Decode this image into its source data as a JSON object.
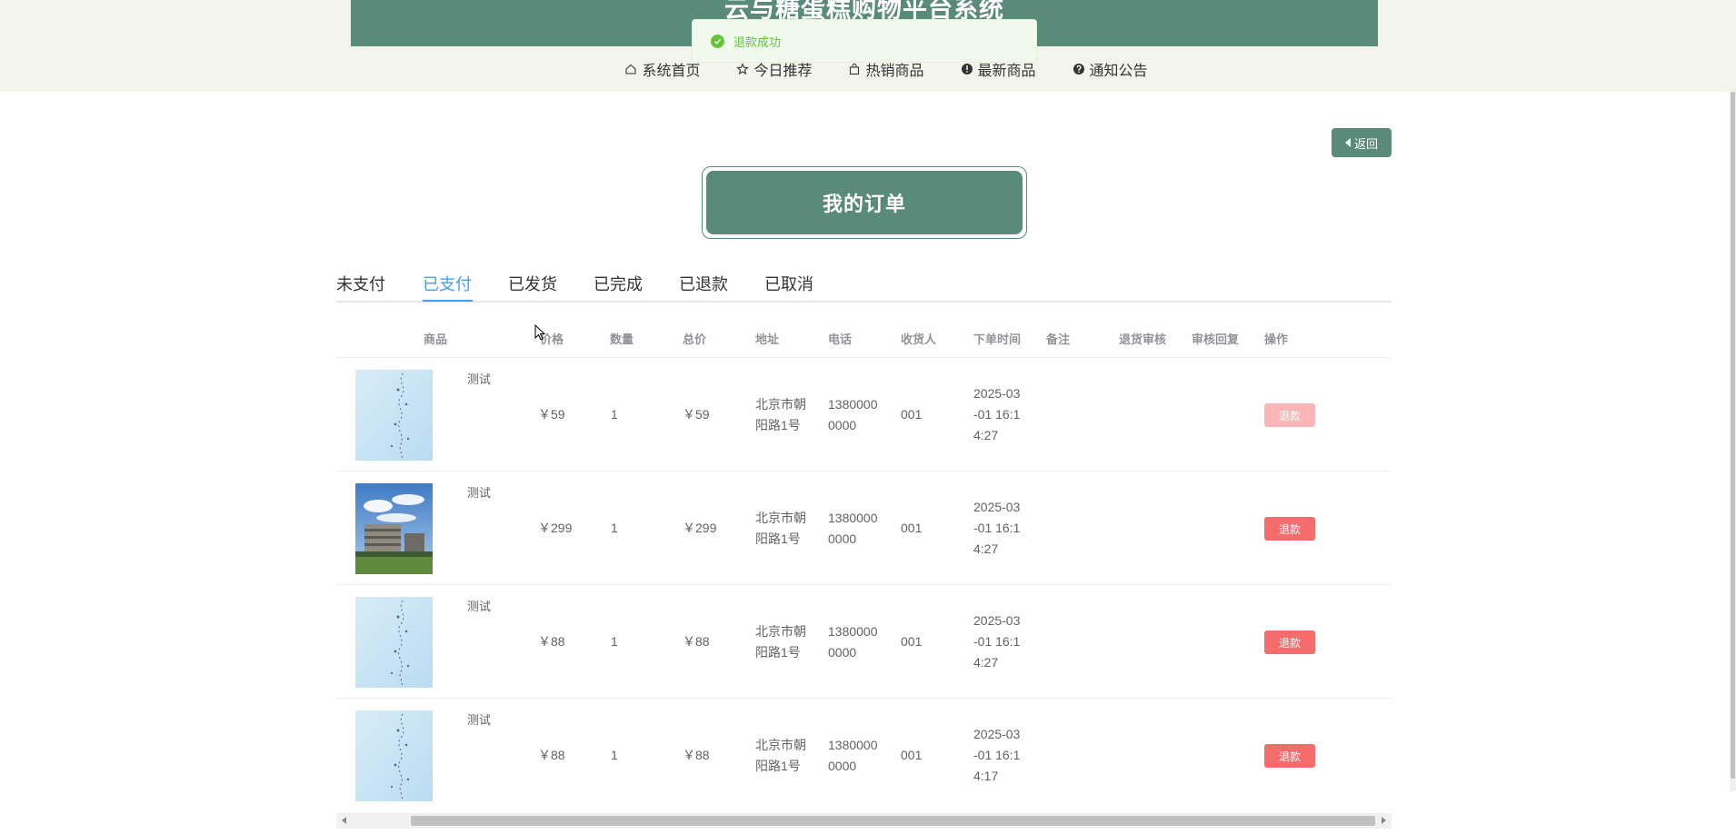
{
  "header": {
    "site_title": "云与糖蛋糕购物平台系统",
    "nav": [
      {
        "label": "系统首页",
        "icon": "home-icon"
      },
      {
        "label": "今日推荐",
        "icon": "star-icon"
      },
      {
        "label": "热销商品",
        "icon": "bag-icon"
      },
      {
        "label": "最新商品",
        "icon": "info-icon"
      },
      {
        "label": "通知公告",
        "icon": "question-icon"
      }
    ]
  },
  "toast": {
    "message": "退款成功",
    "icon": "success-check-icon"
  },
  "back_button": {
    "label": "返回"
  },
  "page_title": "我的订单",
  "tabs": {
    "items": [
      "未支付",
      "已支付",
      "已发货",
      "已完成",
      "已退款",
      "已取消"
    ],
    "active": "已支付"
  },
  "table": {
    "columns": [
      "商品",
      "价格",
      "数量",
      "总价",
      "地址",
      "电话",
      "收货人",
      "下单时间",
      "备注",
      "退货审核",
      "审核回复",
      "操作"
    ],
    "rows": [
      {
        "name": "测试",
        "price": "￥59",
        "qty": "1",
        "total": "￥59",
        "address_1": "北京市朝",
        "address_2": "阳路1号",
        "phone_1": "1380000",
        "phone_2": "0000",
        "receiver": "001",
        "time_1": "2025-03",
        "time_2": "-01 16:1",
        "time_3": "4:27",
        "image": "water-drops-photo",
        "action": "退款",
        "action_disabled": true
      },
      {
        "name": "测试",
        "price": "￥299",
        "qty": "1",
        "total": "￥299",
        "address_1": "北京市朝",
        "address_2": "阳路1号",
        "phone_1": "1380000",
        "phone_2": "0000",
        "receiver": "001",
        "time_1": "2025-03",
        "time_2": "-01 16:1",
        "time_3": "4:27",
        "image": "building-photo",
        "action": "退款",
        "action_disabled": false
      },
      {
        "name": "测试",
        "price": "￥88",
        "qty": "1",
        "total": "￥88",
        "address_1": "北京市朝",
        "address_2": "阳路1号",
        "phone_1": "1380000",
        "phone_2": "0000",
        "receiver": "001",
        "time_1": "2025-03",
        "time_2": "-01 16:1",
        "time_3": "4:27",
        "image": "water-drops-photo",
        "action": "退款",
        "action_disabled": false
      },
      {
        "name": "测试",
        "price": "￥88",
        "qty": "1",
        "total": "￥88",
        "address_1": "北京市朝",
        "address_2": "阳路1号",
        "phone_1": "1380000",
        "phone_2": "0000",
        "receiver": "001",
        "time_1": "2025-03",
        "time_2": "-01 16:1",
        "time_3": "4:17",
        "image": "water-drops-photo",
        "action": "退款",
        "action_disabled": false
      }
    ]
  },
  "colors": {
    "primary": "#5a8a7a",
    "header_bg": "#f3f4ec",
    "tab_active": "#409eff",
    "danger": "#f56c6c",
    "success": "#67c23a"
  }
}
